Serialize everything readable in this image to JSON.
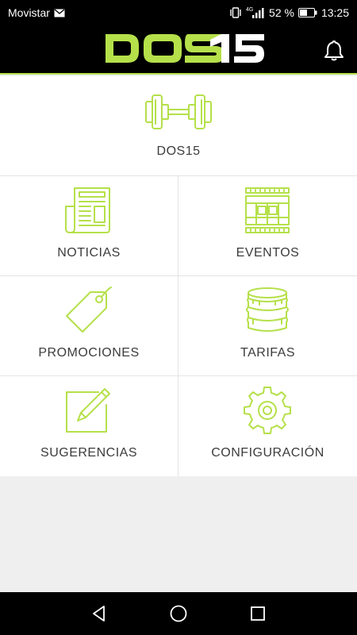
{
  "status_bar": {
    "carrier": "Movistar",
    "network": "4G",
    "battery_percent": "52 %",
    "time": "13:25",
    "icons": [
      "mail-icon",
      "vibrate-icon",
      "signal-icon",
      "battery-icon"
    ]
  },
  "header": {
    "logo_text": "DOS15",
    "logo_colors": {
      "main": "#b5e04a",
      "accent": "#ffffff"
    },
    "bell_icon": "bell-icon"
  },
  "hero": {
    "label": "DOS15",
    "icon": "dumbbell-icon"
  },
  "menu": {
    "items": [
      {
        "label": "NOTICIAS",
        "icon": "newspaper-icon"
      },
      {
        "label": "EVENTOS",
        "icon": "calendar-icon"
      },
      {
        "label": "PROMOCIONES",
        "icon": "price-tag-icon"
      },
      {
        "label": "TARIFAS",
        "icon": "coins-icon"
      },
      {
        "label": "SUGERENCIAS",
        "icon": "pencil-note-icon"
      },
      {
        "label": "CONFIGURACIÓN",
        "icon": "gear-icon"
      }
    ]
  },
  "nav_bar": {
    "buttons": [
      "back-icon",
      "home-icon",
      "recents-icon"
    ]
  },
  "colors": {
    "accent": "#b5e04a",
    "text": "#3c3c3c",
    "bar": "#000000",
    "background": "#efefef"
  }
}
